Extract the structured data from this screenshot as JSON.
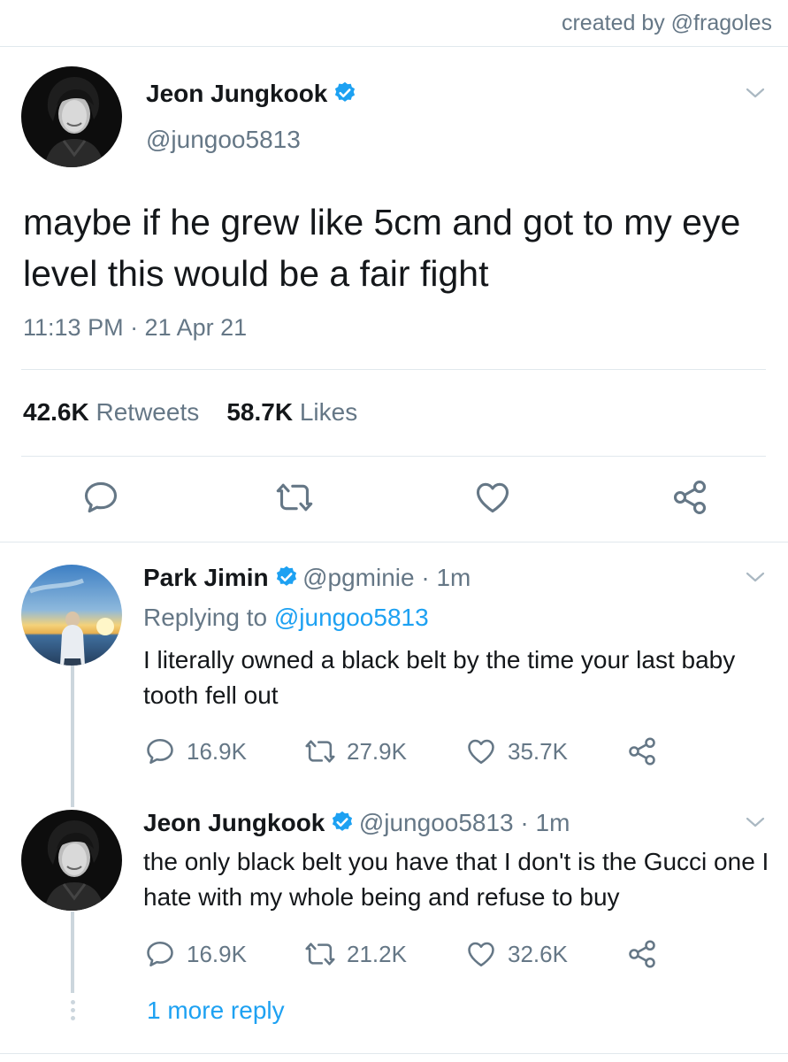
{
  "credit": "created by @fragoles",
  "main_tweet": {
    "name": "Jeon Jungkook",
    "handle": "@jungoo5813",
    "text": "maybe if he grew like 5cm and got to my eye level this would be a fair fight",
    "timestamp": "11:13 PM · 21 Apr 21",
    "retweets_count": "42.6K",
    "retweets_label": "Retweets",
    "likes_count": "58.7K",
    "likes_label": "Likes"
  },
  "replies": [
    {
      "name": "Park Jimin",
      "handle_time": "@pgminie · 1m",
      "replying_prefix": "Replying to",
      "replying_handle": "@jungoo5813",
      "text": "I literally owned a black belt by the time your last baby tooth fell out",
      "reply_count": "16.9K",
      "retweet_count": "27.9K",
      "like_count": "35.7K"
    },
    {
      "name": "Jeon Jungkook",
      "handle_time": "@jungoo5813 · 1m",
      "text": "the only black belt you have that I don't is the Gucci one I hate with my whole being and refuse to buy",
      "reply_count": "16.9K",
      "retweet_count": "21.2K",
      "like_count": "32.6K"
    }
  ],
  "more_replies": "1 more reply",
  "colors": {
    "accent": "#1da1f2",
    "muted": "#657786",
    "text": "#14171a",
    "divider": "#e1e8ed"
  }
}
